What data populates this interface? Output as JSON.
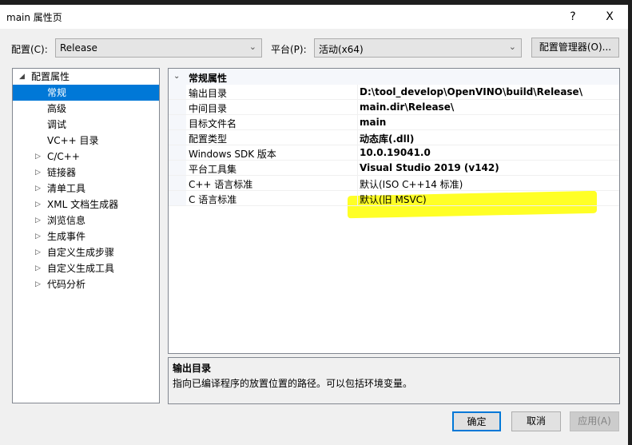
{
  "window": {
    "title": "main 属性页",
    "help": "?",
    "close": "X"
  },
  "toolbar": {
    "config_label": "配置(C):",
    "config_value": "Release",
    "platform_label": "平台(P):",
    "platform_value": "活动(x64)",
    "config_manager": "配置管理器(O)..."
  },
  "tree": [
    {
      "label": "配置属性",
      "level": 0,
      "expanded": true
    },
    {
      "label": "常规",
      "level": 1,
      "selected": true
    },
    {
      "label": "高级",
      "level": 1
    },
    {
      "label": "调试",
      "level": 1
    },
    {
      "label": "VC++ 目录",
      "level": 1
    },
    {
      "label": "C/C++",
      "level": 1,
      "collapsed": true
    },
    {
      "label": "链接器",
      "level": 1,
      "collapsed": true
    },
    {
      "label": "清单工具",
      "level": 1,
      "collapsed": true
    },
    {
      "label": "XML 文档生成器",
      "level": 1,
      "collapsed": true
    },
    {
      "label": "浏览信息",
      "level": 1,
      "collapsed": true
    },
    {
      "label": "生成事件",
      "level": 1,
      "collapsed": true
    },
    {
      "label": "自定义生成步骤",
      "level": 1,
      "collapsed": true
    },
    {
      "label": "自定义生成工具",
      "level": 1,
      "collapsed": true
    },
    {
      "label": "代码分析",
      "level": 1,
      "collapsed": true
    }
  ],
  "grid": {
    "section": "常规属性",
    "rows": [
      {
        "key": "输出目录",
        "value": "D:\\tool_develop\\OpenVINO\\build\\Release\\",
        "bold": true
      },
      {
        "key": "中间目录",
        "value": "main.dir\\Release\\",
        "bold": true
      },
      {
        "key": "目标文件名",
        "value": "main",
        "bold": true
      },
      {
        "key": "配置类型",
        "value": "动态库(.dll)",
        "bold": true,
        "highlight": "#ffff00"
      },
      {
        "key": "Windows SDK 版本",
        "value": "10.0.19041.0",
        "bold": true
      },
      {
        "key": "平台工具集",
        "value": "Visual Studio 2019 (v142)",
        "bold": true
      },
      {
        "key": "C++ 语言标准",
        "value": "默认(ISO C++14 标准)",
        "bold": false
      },
      {
        "key": "C 语言标准",
        "value": "默认(旧 MSVC)",
        "bold": false
      }
    ]
  },
  "description": {
    "title": "输出目录",
    "text": "指向已编译程序的放置位置的路径。可以包括环境变量。"
  },
  "buttons": {
    "ok": "确定",
    "cancel": "取消",
    "apply": "应用(A)"
  },
  "colors": {
    "selection": "#0078d7",
    "highlight": "#ffff00"
  }
}
